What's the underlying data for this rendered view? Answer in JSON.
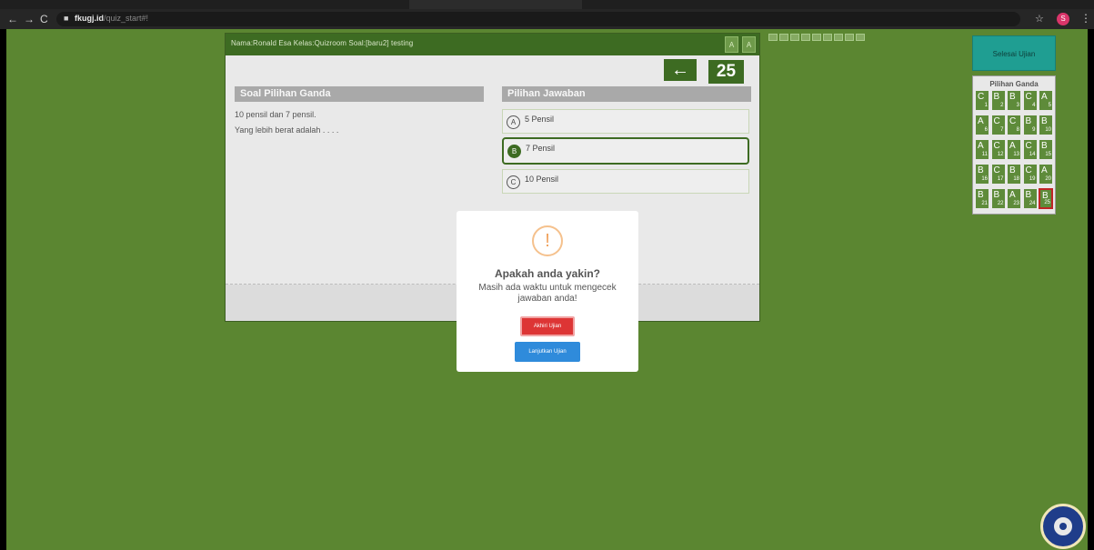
{
  "browser": {
    "url_domain": "fkugj.id",
    "url_path": "/quiz_start#!",
    "profile_initial": "S"
  },
  "quiz": {
    "header_info": "Nama:Ronald Esa   Kelas:Quizroom   Soal:[baru2] testing",
    "mini_buttons": [
      "A",
      "A"
    ],
    "question_number": "25",
    "question_section_title": "Soal Pilihan Ganda",
    "answer_section_title": "Pilihan Jawaban",
    "question_lines": [
      "10 pensil dan 7 pensil.",
      "Yang lebih berat adalah . . . ."
    ],
    "options": [
      {
        "letter": "A",
        "text": "5 Pensil",
        "selected": false
      },
      {
        "letter": "B",
        "text": "7 Pensil",
        "selected": true
      },
      {
        "letter": "C",
        "text": "10 Pensil",
        "selected": false
      }
    ]
  },
  "sidebar": {
    "finish_label": "Selesai Ujian",
    "grid_title": "Pilihan Ganda",
    "answers": [
      "C",
      "B",
      "B",
      "C",
      "A",
      "A",
      "C",
      "C",
      "B",
      "B",
      "A",
      "C",
      "A",
      "C",
      "B",
      "B",
      "C",
      "B",
      "C",
      "A",
      "B",
      "B",
      "A",
      "B",
      "B"
    ],
    "current_question": 25
  },
  "modal": {
    "icon": "!",
    "title": "Apakah anda yakin?",
    "text": "Masih ada waktu untuk mengecek jawaban anda!",
    "end_label": "Akhiri Ujian",
    "continue_label": "Lanjutkan Ujian"
  },
  "colors": {
    "page_bg": "#5b8631",
    "accent_green": "#3d6b22",
    "finish_teal": "#1f9e92",
    "danger": "#dd3535",
    "primary": "#2f8bdb"
  }
}
